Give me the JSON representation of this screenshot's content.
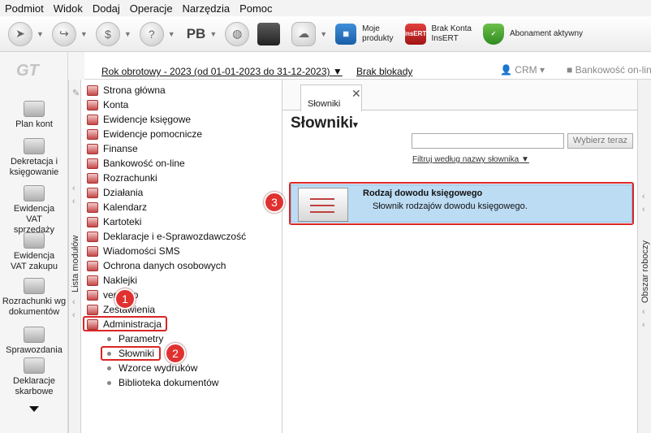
{
  "menu": {
    "items": [
      "Podmiot",
      "Widok",
      "Dodaj",
      "Operacje",
      "Narzędzia",
      "Pomoc"
    ]
  },
  "toolbar": {
    "pb_label": "PB",
    "moje_produkty": [
      "Moje",
      "produkty"
    ],
    "brak_konta": [
      "Brak Konta",
      "InsERT"
    ],
    "brak_konta_badge": "InsERT",
    "abonament": "Abonament aktywny"
  },
  "left_panel": {
    "logo": "GT",
    "items": [
      "Plan kont",
      "Dekretacja i księgowanie",
      "Ewidencja VAT sprzedaży",
      "Ewidencja VAT zakupu",
      "Rozrachunki wg dokumentów",
      "Sprawozdania",
      "Deklaracje skarbowe"
    ]
  },
  "header": {
    "year": "Rok obrotowy - 2023  (od 01-01-2023 do 31-12-2023)",
    "blokady": "Brak blokady",
    "crm": "CRM",
    "bank": "Bankowość on-line"
  },
  "side_labels": {
    "left": "Lista modułów",
    "right": "Obszar roboczy"
  },
  "tree": {
    "items": [
      "Strona główna",
      "Konta",
      "Ewidencje księgowe",
      "Ewidencje pomocnicze",
      "Finanse",
      "Bankowość on-line",
      "Rozrachunki",
      "Działania",
      "Kalendarz",
      "Kartoteki",
      "Deklaracje i e-Sprawozdawczość",
      "Wiadomości SMS",
      "Ochrona danych osobowych",
      "Naklejki",
      "vendero",
      "Zestawienia",
      "Administracja"
    ],
    "sub_items": [
      "Parametry",
      "Słowniki",
      "Wzorce wydruków",
      "Biblioteka dokumentów"
    ]
  },
  "content": {
    "tab_label": "Słowniki",
    "title": "Słowniki",
    "search_button": "Wybierz teraz",
    "search_value": "",
    "filter": "Filtruj według nazwy słownika",
    "dictionary": {
      "title": "Rodzaj dowodu księgowego",
      "description": "Słownik rodzajów dowodu księgowego."
    }
  },
  "annotations": [
    "1",
    "2",
    "3"
  ],
  "colors": {
    "highlight": "#d92626",
    "selection": "#bcdcf4"
  }
}
